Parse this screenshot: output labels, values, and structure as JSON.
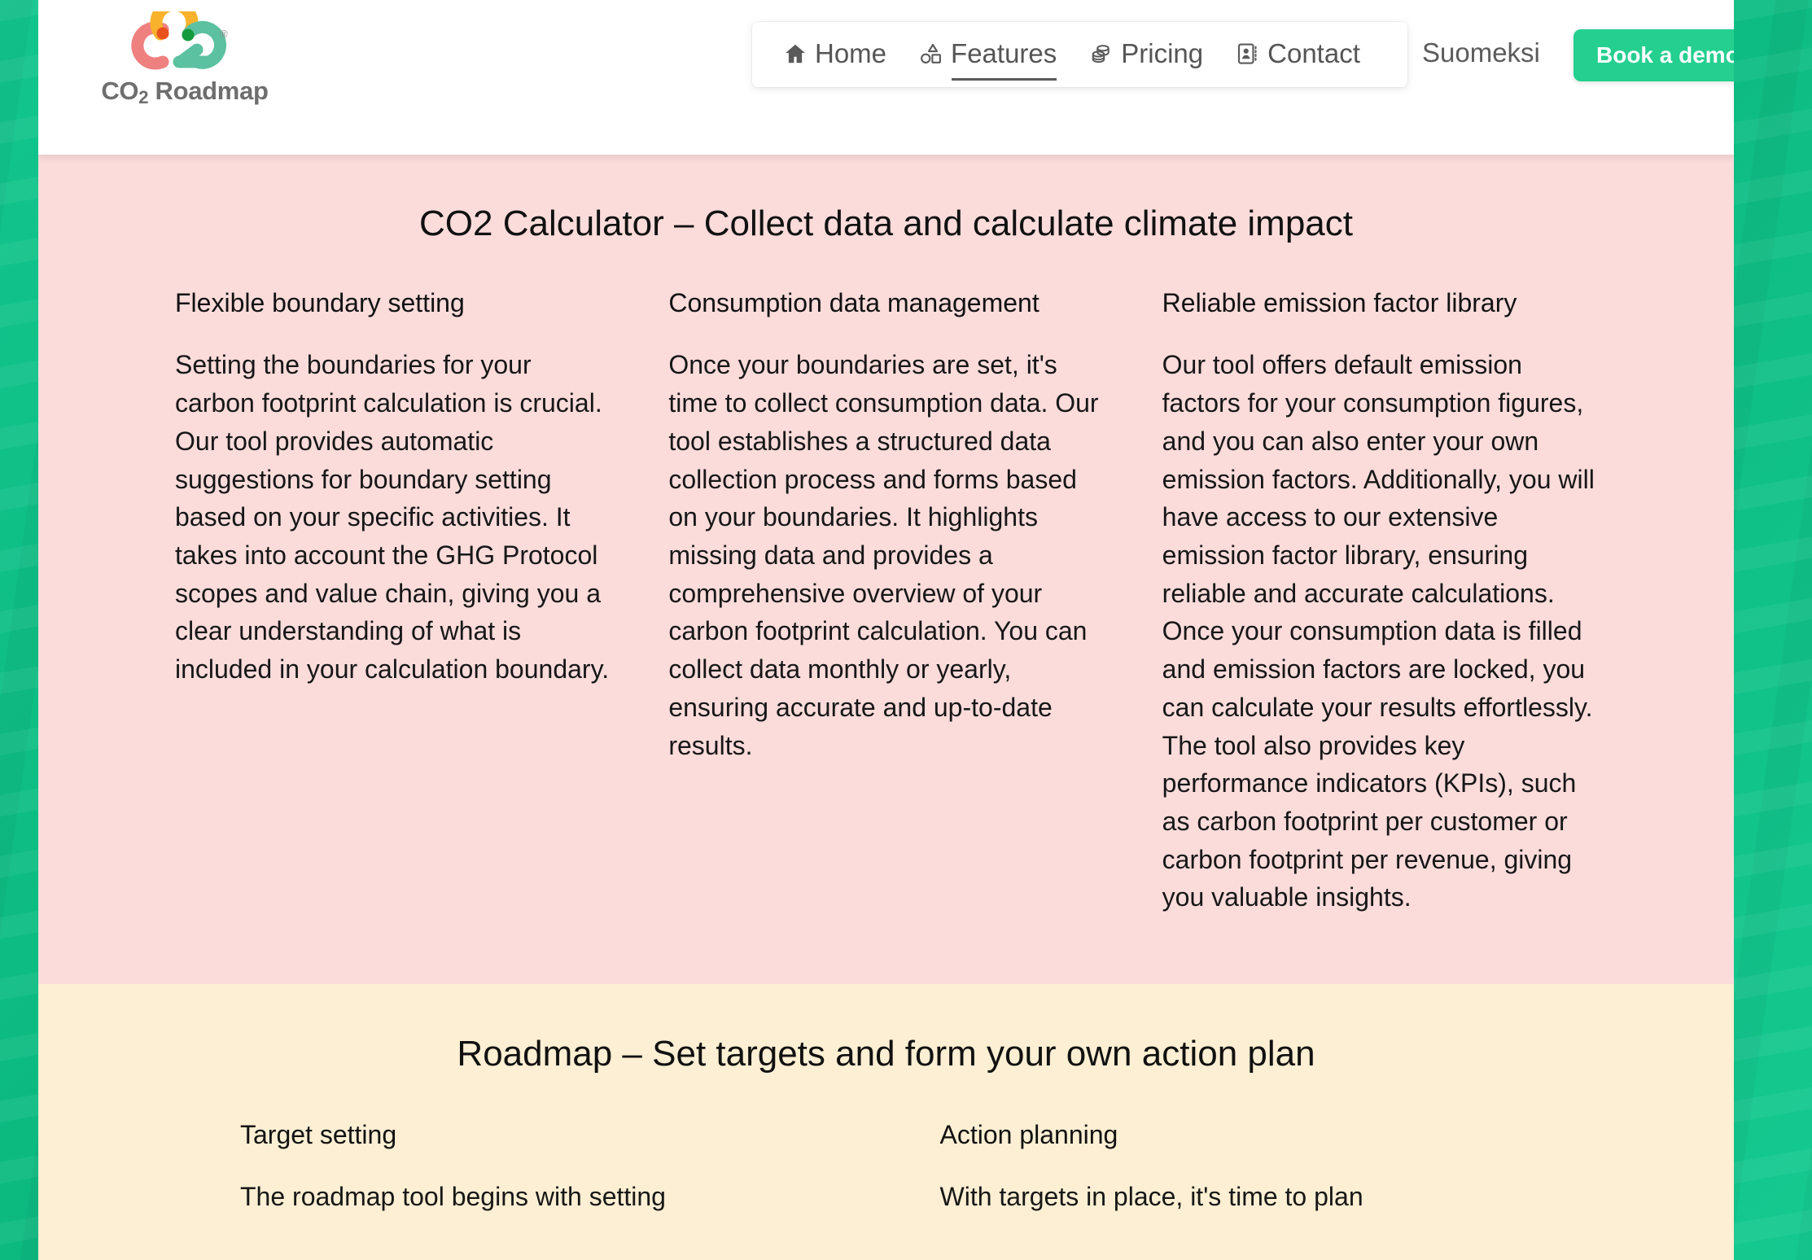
{
  "theme": {
    "page_backdrop": "#0fbf86",
    "header_bg": "#ffffff",
    "section_pink_bg": "#fbdcdb",
    "section_yellow_bg": "#fdefd3",
    "accent_green": "#24cf8f",
    "nav_text": "#555555",
    "body_text": "#171717"
  },
  "header": {
    "brand": {
      "name": "CO2 Roadmap",
      "name_main": "CO",
      "name_sub": "2",
      "name_tail": " Roadmap",
      "logo_icon": "co2-cloud-logo",
      "trademark": "®",
      "logo_colors": {
        "left_c": "#ef8080",
        "top_o": "#f9b22c",
        "right_2": "#5cc1a0",
        "dot_orange": "#e8511c",
        "dot_green": "#149a3c"
      }
    },
    "nav": [
      {
        "label": "Home",
        "icon": "home-icon",
        "active": false
      },
      {
        "label": "Features",
        "icon": "shapes-icon",
        "active": true
      },
      {
        "label": "Pricing",
        "icon": "coins-icon",
        "active": false
      },
      {
        "label": "Contact",
        "icon": "contact-card-icon",
        "active": false
      }
    ],
    "language_link": "Suomeksi",
    "cta_button": "Book a demo"
  },
  "sections": [
    {
      "id": "co2-calculator",
      "title": "CO2 Calculator – Collect data and calculate climate impact",
      "columns": [
        {
          "heading": "Flexible boundary setting",
          "body": "Setting the boundaries for your carbon footprint calculation is crucial. Our tool provides automatic suggestions for boundary setting based on your specific activities. It takes into account the GHG Protocol scopes and value chain, giving you a clear understanding of what is included in your calculation boundary."
        },
        {
          "heading": "Consumption data management",
          "body": "Once your boundaries are set, it's time to collect consumption data. Our tool establishes a structured data collection process and forms based on your boundaries. It highlights missing data and provides a comprehensive overview of your carbon footprint calculation. You can collect data monthly or yearly, ensuring accurate and up-to-date results."
        },
        {
          "heading": "Reliable emission factor library",
          "body": "Our tool offers default emission factors for your consumption figures, and you can also enter your own emission factors. Additionally, you will have access to our extensive emission factor library, ensuring reliable and accurate calculations. Once your consumption data is filled and emission factors are locked, you can calculate your results effortlessly. The tool also provides key performance indicators (KPIs), such as carbon footprint per customer or carbon footprint per revenue, giving you valuable insights."
        }
      ]
    },
    {
      "id": "roadmap",
      "title": "Roadmap – Set targets and form your own action plan",
      "columns": [
        {
          "heading": "Target setting",
          "body": "The roadmap tool begins with setting"
        },
        {
          "heading": "Action planning",
          "body": "With targets in place, it's time to plan"
        }
      ]
    }
  ]
}
